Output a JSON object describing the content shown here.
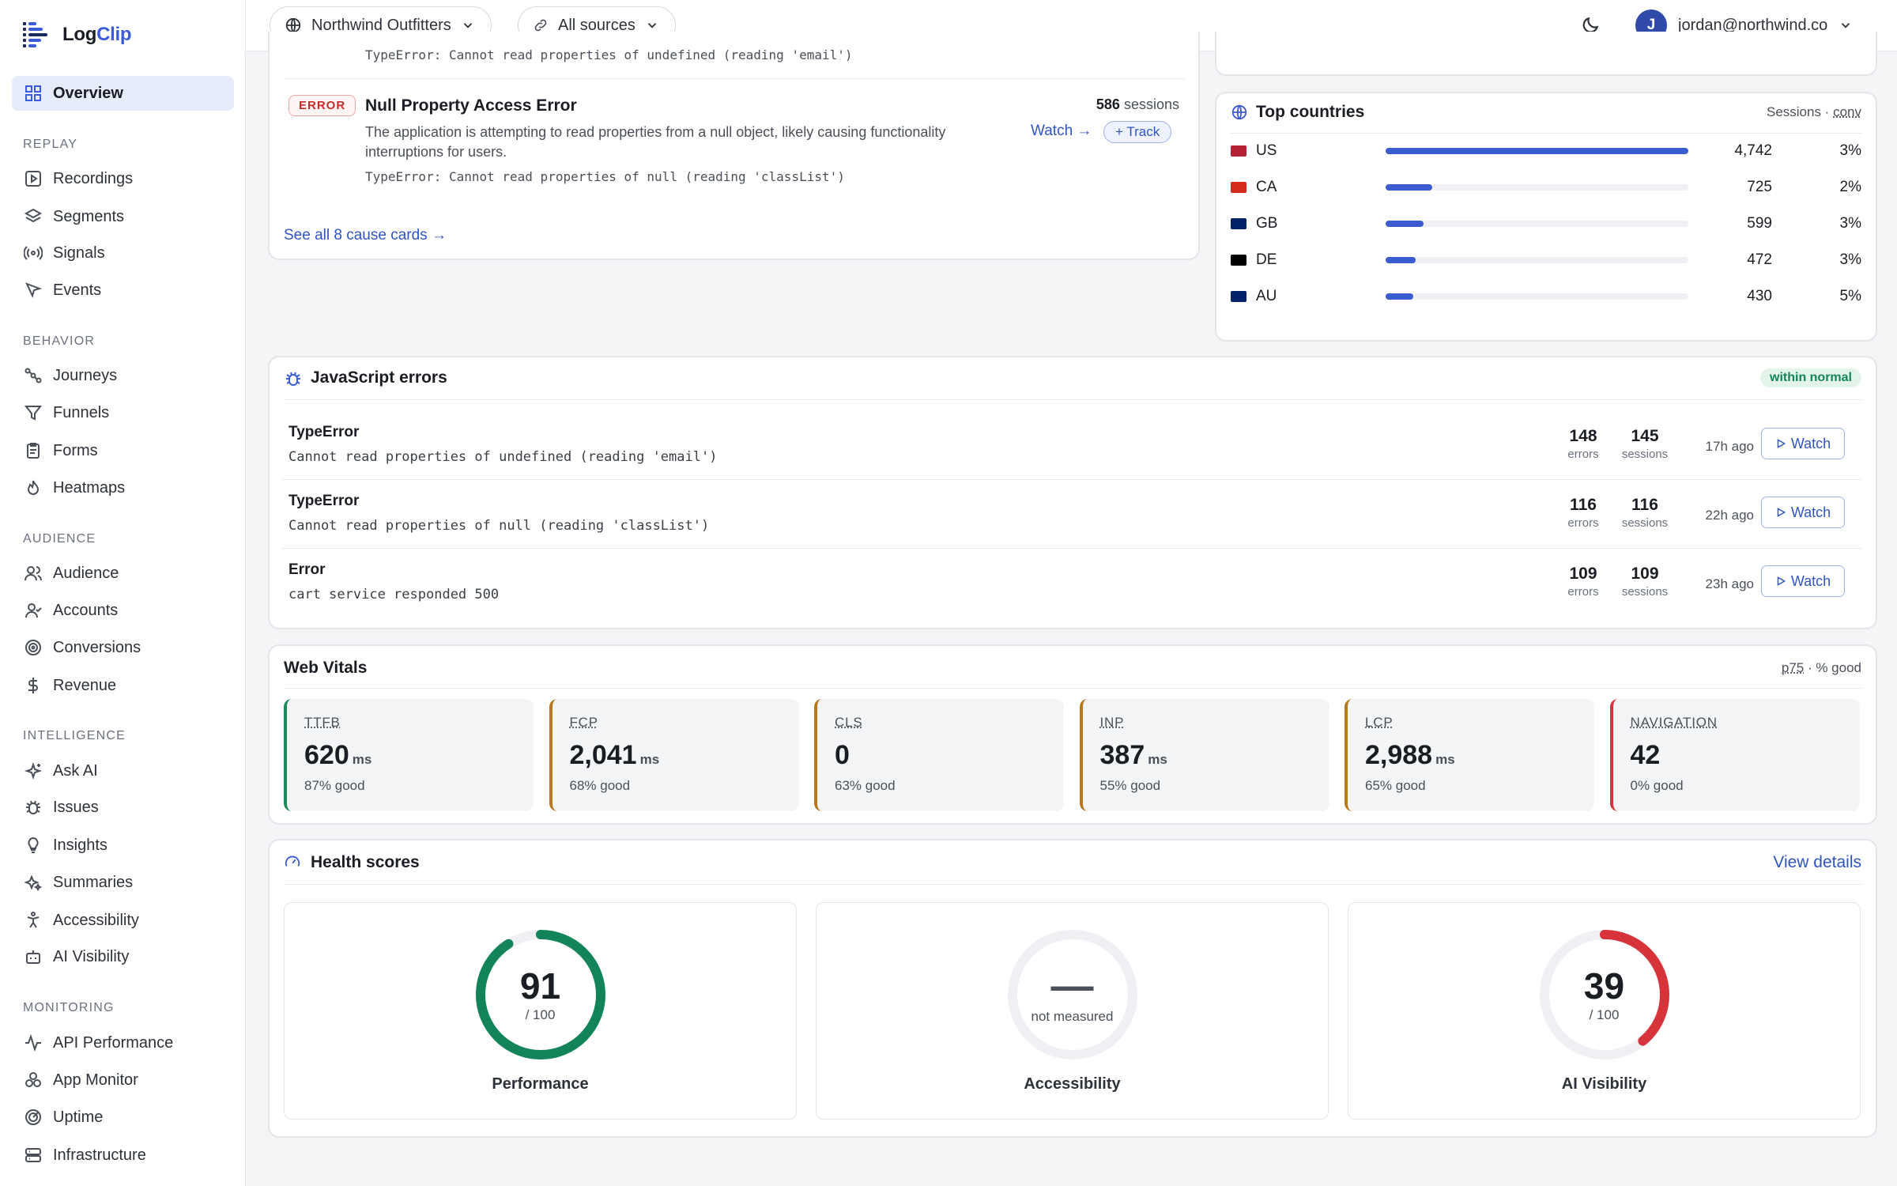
{
  "app": {
    "name_a": "Log",
    "name_b": "Clip"
  },
  "sidebar": {
    "overview": "Overview",
    "sections": [
      {
        "title": "REPLAY",
        "items": [
          "Recordings",
          "Segments",
          "Signals",
          "Events"
        ]
      },
      {
        "title": "BEHAVIOR",
        "items": [
          "Journeys",
          "Funnels",
          "Forms",
          "Heatmaps"
        ]
      },
      {
        "title": "AUDIENCE",
        "items": [
          "Audience",
          "Accounts",
          "Conversions",
          "Revenue"
        ]
      },
      {
        "title": "INTELLIGENCE",
        "items": [
          "Ask AI",
          "Issues",
          "Insights",
          "Summaries",
          "Accessibility",
          "AI Visibility"
        ]
      },
      {
        "title": "MONITORING",
        "items": [
          "API Performance",
          "App Monitor",
          "Uptime",
          "Infrastructure"
        ]
      }
    ]
  },
  "topbar": {
    "workspace": "Northwind Outfitters",
    "sources": "All sources",
    "user_initial": "J",
    "user_email": "jordan@northwind.co"
  },
  "causes": {
    "prev_code": "TypeError: Cannot read properties of undefined (reading 'email')",
    "card": {
      "tag": "ERROR",
      "title": "Null Property Access Error",
      "sessions_num": "586",
      "sessions_label": "sessions",
      "desc1": "The application is attempting to read properties from a null object, likely causing functionality",
      "desc2": "interruptions for users.",
      "code": "TypeError: Cannot read properties of null (reading 'classList')",
      "watch": "Watch →",
      "track": "+ Track"
    },
    "see_all": "See all 8 cause cards →"
  },
  "countries": {
    "title": "Top countries",
    "meta_a": "Sessions · ",
    "meta_b": "conv",
    "rows": [
      {
        "code": "US",
        "value": "4,742",
        "pct": "3%",
        "share": 1.0
      },
      {
        "code": "CA",
        "value": "725",
        "pct": "2%",
        "share": 0.153
      },
      {
        "code": "GB",
        "value": "599",
        "pct": "3%",
        "share": 0.126
      },
      {
        "code": "DE",
        "value": "472",
        "pct": "3%",
        "share": 0.1
      },
      {
        "code": "AU",
        "value": "430",
        "pct": "5%",
        "share": 0.091
      }
    ]
  },
  "js_errors": {
    "title": "JavaScript errors",
    "badge": "within normal",
    "rows": [
      {
        "type": "TypeError",
        "msg": "Cannot read properties of undefined (reading 'email')",
        "errors": "148",
        "sessions": "145",
        "ago": "17h ago"
      },
      {
        "type": "TypeError",
        "msg": "Cannot read properties of null (reading 'classList')",
        "errors": "116",
        "sessions": "116",
        "ago": "22h ago"
      },
      {
        "type": "Error",
        "msg": "cart service responded 500",
        "errors": "109",
        "sessions": "109",
        "ago": "23h ago"
      }
    ],
    "errors_label": "errors",
    "sessions_label": "sessions",
    "watch": "Watch"
  },
  "vitals": {
    "title": "Web Vitals",
    "meta_a": "p75",
    "meta_b": " · % good",
    "items": [
      {
        "key": "TTFB",
        "value": "620",
        "unit": "ms",
        "good": "87% good",
        "color": "#1e8a5a"
      },
      {
        "key": "FCP",
        "value": "2,041",
        "unit": "ms",
        "good": "68% good",
        "color": "#b7791f"
      },
      {
        "key": "CLS",
        "value": "0",
        "unit": "",
        "good": "63% good",
        "color": "#b7791f"
      },
      {
        "key": "INP",
        "value": "387",
        "unit": "ms",
        "good": "55% good",
        "color": "#b7791f"
      },
      {
        "key": "LCP",
        "value": "2,988",
        "unit": "ms",
        "good": "65% good",
        "color": "#b7791f"
      },
      {
        "key": "NAVIGATION",
        "value": "42",
        "unit": "",
        "good": "0% good",
        "color": "#d6333a"
      }
    ]
  },
  "health": {
    "title": "Health scores",
    "view": "View details",
    "items": [
      {
        "name": "Performance",
        "score": "91",
        "of": "/ 100",
        "fraction": 0.91,
        "color": "#13845a"
      },
      {
        "name": "Accessibility",
        "score": "—",
        "of": "not measured",
        "fraction": 0,
        "color": "#dadde2"
      },
      {
        "name": "AI Visibility",
        "score": "39",
        "of": "/ 100",
        "fraction": 0.39,
        "color": "#d6333a"
      }
    ]
  }
}
